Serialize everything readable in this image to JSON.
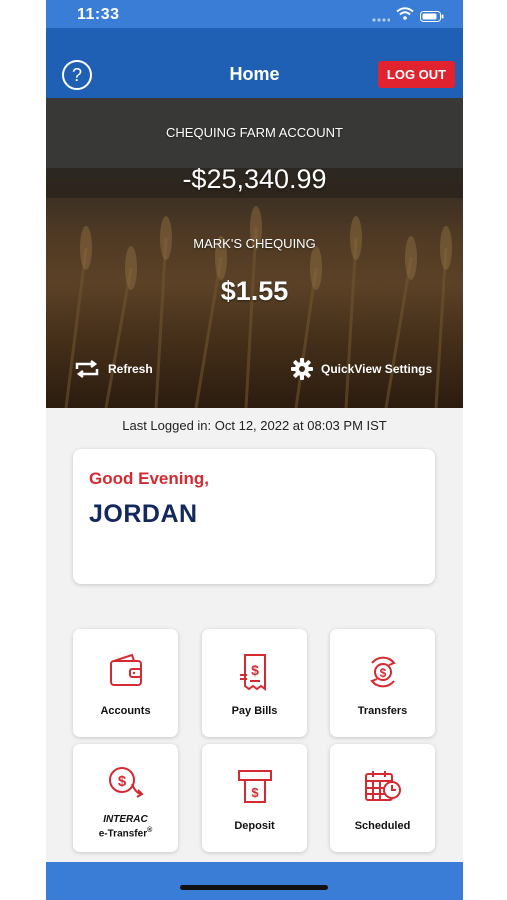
{
  "status_bar": {
    "time": "11:33"
  },
  "nav": {
    "title": "Home",
    "logout_label": "LOG OUT",
    "help_icon": "question-circle-icon"
  },
  "quickview": {
    "accounts": [
      {
        "name": "CHEQUING FARM ACCOUNT",
        "balance": "-$25,340.99"
      },
      {
        "name": "MARK'S CHEQUING",
        "balance": "$1.55"
      }
    ],
    "refresh_label": "Refresh",
    "settings_label": "QuickView Settings"
  },
  "last_logged": "Last Logged in: Oct 12, 2022 at 08:03 PM  IST",
  "greeting": {
    "salutation": "Good Evening,",
    "name": "JORDAN"
  },
  "tiles": [
    {
      "label": "Accounts",
      "icon": "wallet-icon"
    },
    {
      "label": "Pay Bills",
      "icon": "bill-icon"
    },
    {
      "label": "Transfers",
      "icon": "transfer-icon"
    },
    {
      "label_line1": "INTERAC",
      "label_line2": "e-Transfer",
      "label_sup": "®",
      "icon": "etransfer-icon"
    },
    {
      "label": "Deposit",
      "icon": "atm-icon"
    },
    {
      "label": "Scheduled",
      "icon": "calendar-clock-icon"
    }
  ],
  "colors": {
    "nav_blue": "#1f5fb4",
    "accent_red": "#d42a31",
    "name_navy": "#13295e"
  }
}
